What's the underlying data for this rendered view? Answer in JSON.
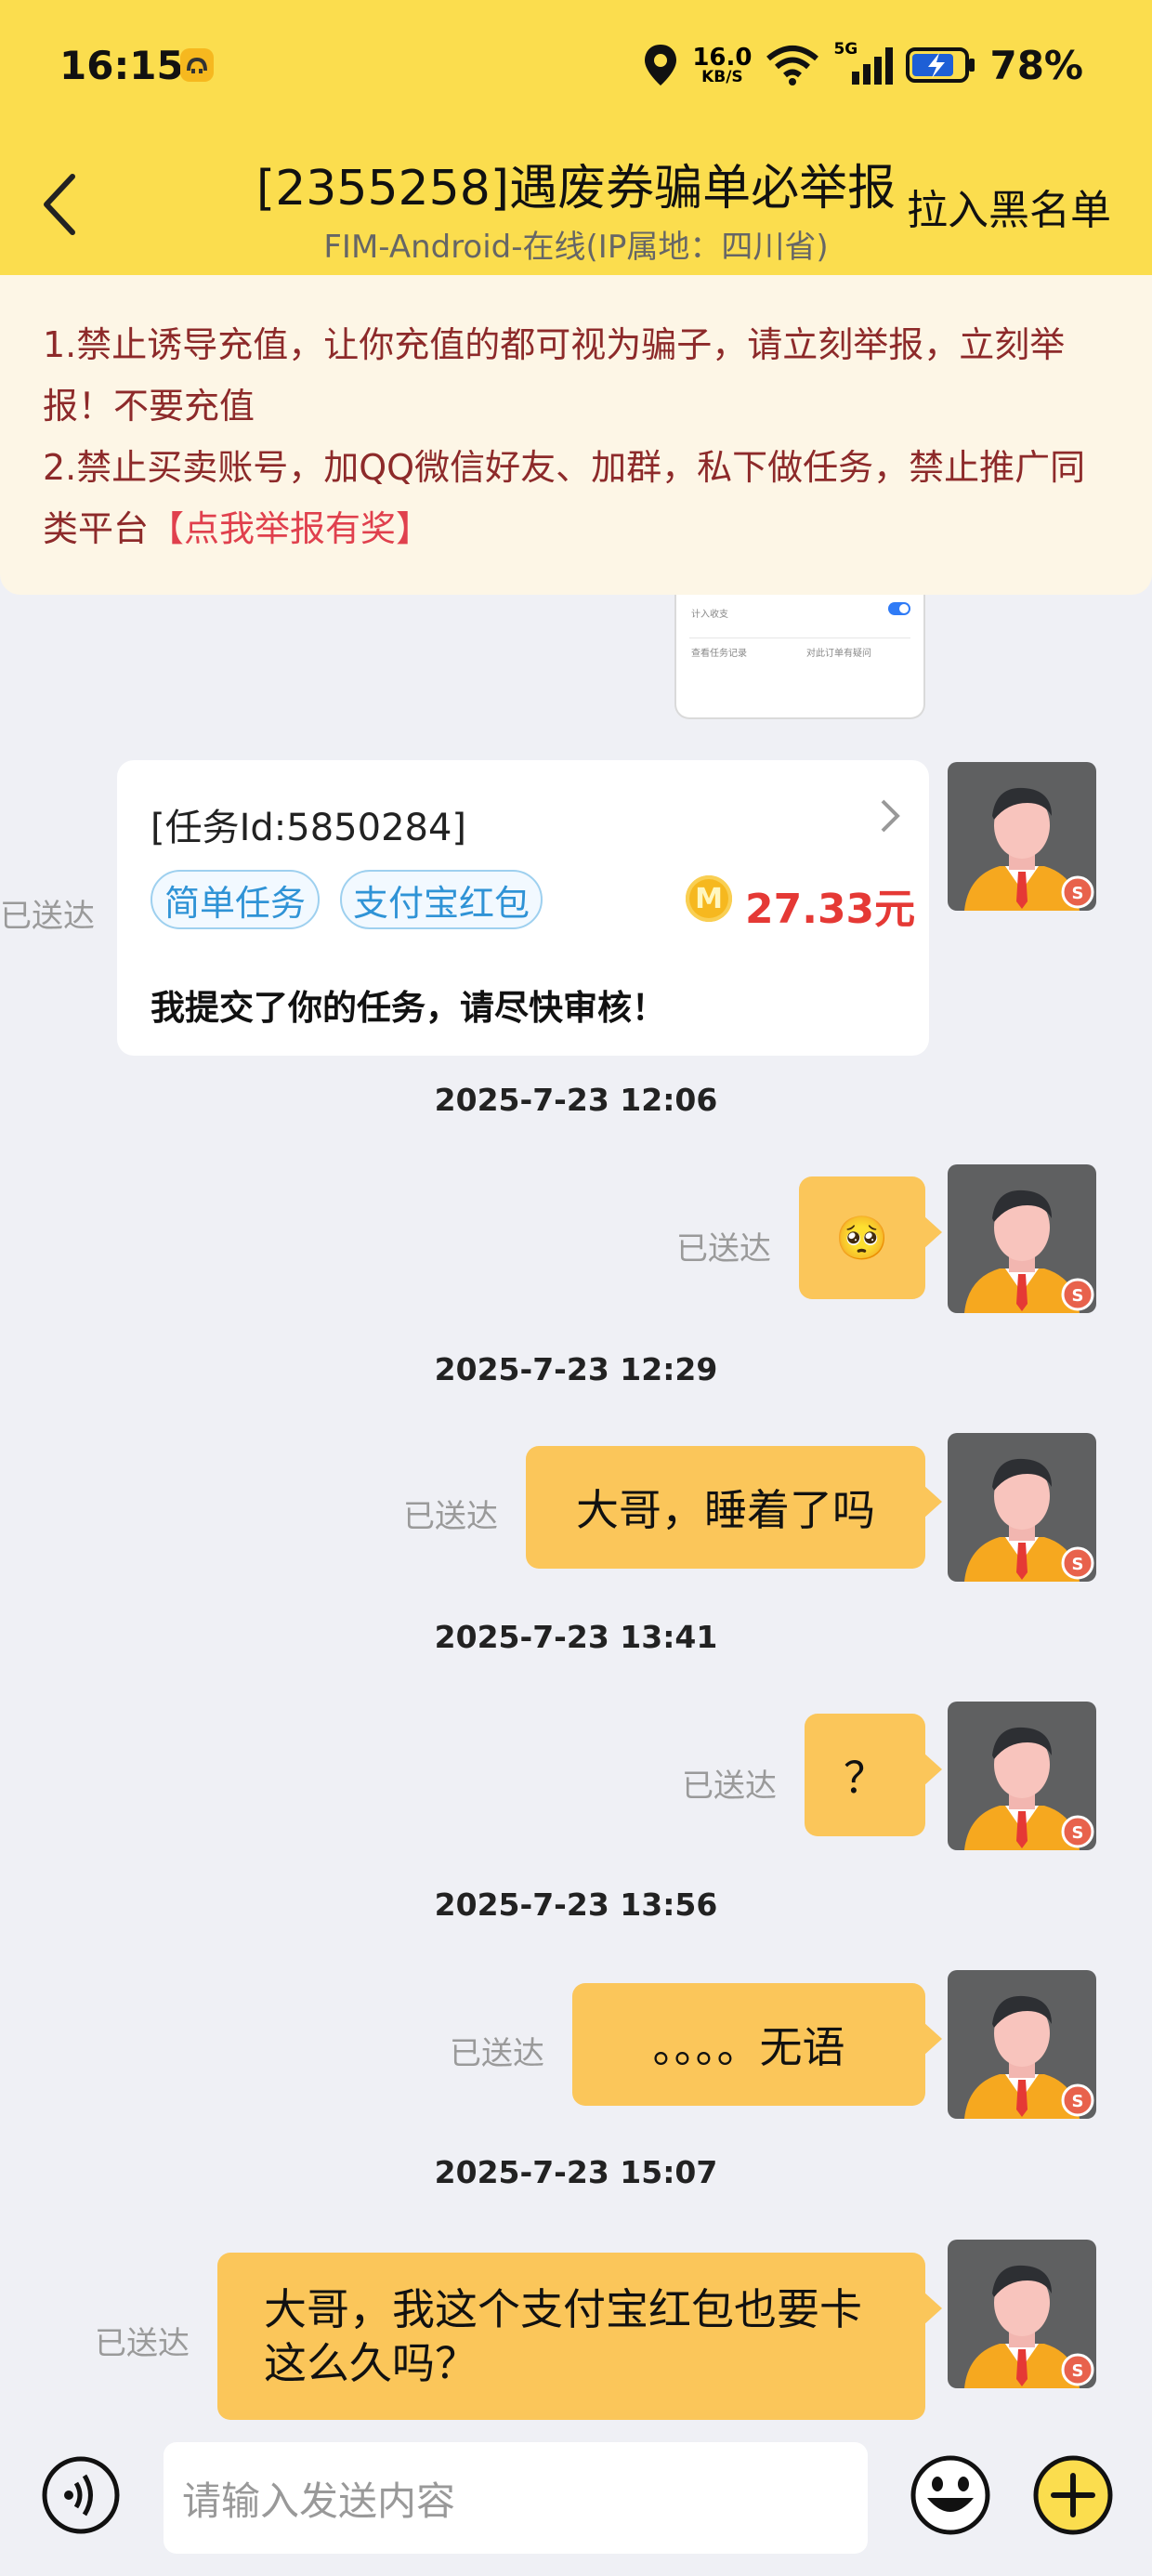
{
  "status_bar": {
    "time": "16:15",
    "net_speed_value": "16.0",
    "net_speed_unit": "KB/S",
    "signal_label": "5G",
    "battery": "78%"
  },
  "header": {
    "title": "[2355258]遇废券骗单必举报",
    "subtitle": "FIM-Android-在线(IP属地：四川省)",
    "blacklist_label": "拉入黑名单"
  },
  "notice": {
    "line1": "1.禁止诱导充值，让你充值的都可视为骗子，请立刻举报，立刻举报！不要充值",
    "line2": "2.禁止买卖账号，加QQ微信好友、加群，私下做任务，禁止推广同类平台",
    "report_link": "【点我举报有奖】"
  },
  "snapshot": {
    "row1": "计入收支",
    "link1": "查看任务记录",
    "link2": "对此订单有疑问"
  },
  "task_card": {
    "task_id": "[任务Id:5850284]",
    "tag1": "简单任务",
    "tag2": "支付宝红包",
    "coin_letter": "M",
    "amount": "27.33元",
    "message": "我提交了你的任务，请尽快审核！",
    "status": "已送达"
  },
  "messages": [
    {
      "timestamp": "2025-7-23 12:06",
      "text": "🥺",
      "status": "已送达"
    },
    {
      "timestamp": "2025-7-23 12:29",
      "text": "大哥，睡着了吗",
      "status": "已送达"
    },
    {
      "timestamp": "2025-7-23 13:41",
      "text": "？",
      "status": "已送达"
    },
    {
      "timestamp": "2025-7-23 13:56",
      "text": "。。。。无语",
      "status": "已送达"
    },
    {
      "timestamp": "2025-7-23 15:07",
      "text": "大哥，我这个支付宝红包也要卡这么久吗？",
      "status": "已送达"
    }
  ],
  "input": {
    "placeholder": "请输入发送内容"
  },
  "colors": {
    "header_yellow": "#fbdd4e",
    "bubble_yellow": "#fbc65a",
    "notice_bg": "#fdf6e6",
    "notice_text": "#8d2a2a",
    "report_red": "#e0404d",
    "amount_red": "#e53935",
    "tag_blue": "#2f93d6"
  },
  "icons": [
    "location-icon",
    "wifi-icon",
    "signal-icon",
    "battery-icon",
    "back-arrow-icon",
    "voice-icon",
    "emoji-icon",
    "plus-icon",
    "chevron-right-icon",
    "coin-icon"
  ]
}
